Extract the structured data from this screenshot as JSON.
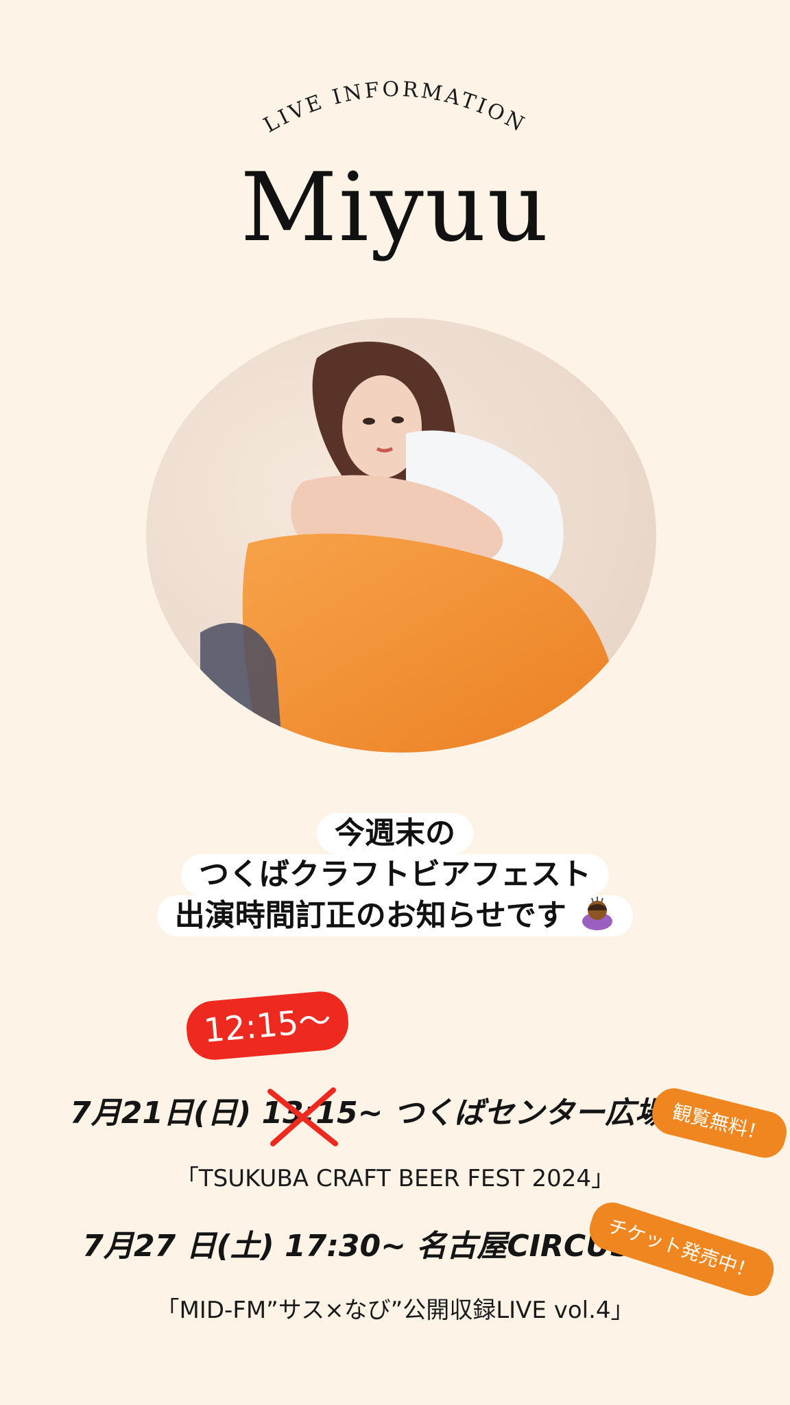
{
  "header": {
    "arc_heading": "LIVE INFORMATION",
    "artist_name": "Miyuu"
  },
  "notice": {
    "line1": "今週末の",
    "line2": "つくばクラフトビアフェスト",
    "line3": "出演時間訂正のお知らせです",
    "emoji_icon": "bowing-person-icon"
  },
  "events": [
    {
      "date": "7月21日(日) ",
      "old_time": "13:15~",
      "venue": " つくばセンター広場",
      "corrected_time": "12:15〜",
      "subtitle": "「TSUKUBA CRAFT BEER FEST 2024」",
      "tag": "観覧無料！"
    },
    {
      "date": "7月27 日(土) ",
      "time": "17:30~",
      "venue": " 名古屋CIRCUS",
      "subtitle": "「MID-FM”サス×なび”公開収録LIVE vol.4」",
      "tag": "チケット発売中！"
    }
  ],
  "colors": {
    "background": "#fdf3e6",
    "correction_red": "#ee2a20",
    "tag_orange": "#f0861f"
  }
}
